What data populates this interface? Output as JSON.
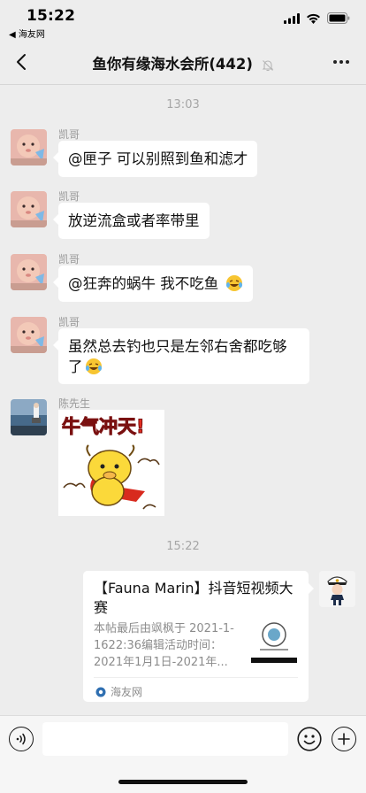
{
  "status": {
    "time": "15:22",
    "back_app": "◀ 海友网"
  },
  "nav": {
    "title": "鱼你有缘海水会所(442)"
  },
  "timestamps": [
    "13:03",
    "15:22"
  ],
  "messages": [
    {
      "sender": "凯哥",
      "text": "@匣子 可以别照到鱼和滤才"
    },
    {
      "sender": "凯哥",
      "text": "放逆流盒或者率带里"
    },
    {
      "sender": "凯哥",
      "text": "@狂奔的蜗牛 我不吃鱼"
    },
    {
      "sender": "凯哥",
      "text_line1": "虽然总去钓也只是左邻右舍都吃够",
      "text_line2": "了"
    },
    {
      "sender": "陈先生",
      "sticker_text": "牛气冲天!"
    }
  ],
  "link_card": {
    "title": "【Fauna Marin】抖音短视频大赛",
    "description": "本帖最后由飒枫于 2021-1-1622:36编辑活动时间：2021年1月1日-2021年...",
    "source": "海友网"
  },
  "input": {
    "value": "",
    "placeholder": ""
  },
  "icons": {
    "back": "chevron-left-icon",
    "mute": "mute-bell-icon",
    "more": "more-dots-icon",
    "voice": "voice-icon",
    "emoji": "emoji-face-icon",
    "plus": "plus-icon"
  },
  "colors": {
    "background": "#ededed",
    "bubble": "#ffffff",
    "meta_text": "#a6a6a6"
  }
}
